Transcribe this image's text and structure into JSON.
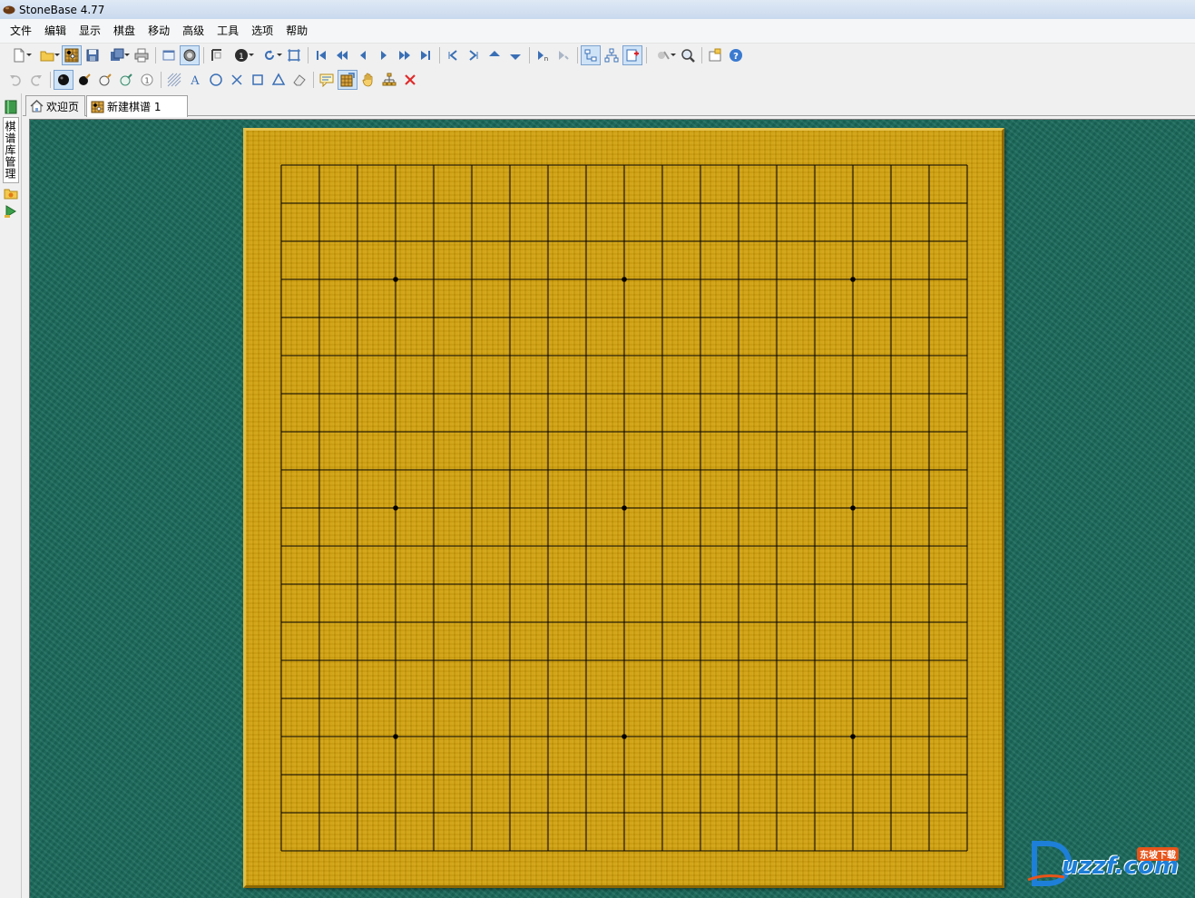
{
  "window": {
    "title": "StoneBase 4.77"
  },
  "menu": {
    "items": [
      "文件",
      "编辑",
      "显示",
      "棋盘",
      "移动",
      "高级",
      "工具",
      "选项",
      "帮助"
    ]
  },
  "toolbar1": {
    "icons": [
      "new-file-icon",
      "open-folder-icon",
      "board-view-icon",
      "save-icon",
      "save-as-icon",
      "print-icon",
      "window-icon",
      "stone-view-icon",
      "coordinates-icon",
      "move-number-icon",
      "rotate-icon",
      "frame-icon",
      "first-move-icon",
      "back-fast-icon",
      "back-icon",
      "forward-icon",
      "forward-fast-icon",
      "last-move-icon",
      "prev-variation-icon",
      "next-variation-icon",
      "up-icon",
      "down-icon",
      "goto-move-icon",
      "goto-end-icon",
      "tree-view-icon",
      "tree-branch-icon",
      "tree-add-icon",
      "analysis-icon",
      "search-icon",
      "properties-icon",
      "help-icon"
    ]
  },
  "toolbar2": {
    "icons": [
      "undo-icon",
      "redo-icon",
      "black-stone-icon",
      "black-move-icon",
      "white-stone-icon",
      "white-move-icon",
      "number-icon",
      "hatch-icon",
      "label-a-icon",
      "circle-icon",
      "cross-icon",
      "square-icon",
      "triangle-icon",
      "eraser-icon",
      "comment-icon",
      "board-edit-icon",
      "hand-icon",
      "tree-icon",
      "delete-icon"
    ],
    "number_label": "1",
    "label_a": "A"
  },
  "sidebar": {
    "panel_label": "棋谱库管理"
  },
  "tabs": [
    {
      "label": "欢迎页",
      "active": false
    },
    {
      "label": "新建棋谱 1",
      "active": true
    }
  ],
  "board": {
    "size": 19,
    "star_points": [
      [
        3,
        3
      ],
      [
        9,
        3
      ],
      [
        15,
        3
      ],
      [
        3,
        9
      ],
      [
        9,
        9
      ],
      [
        15,
        9
      ],
      [
        3,
        15
      ],
      [
        9,
        15
      ],
      [
        15,
        15
      ]
    ],
    "stones": []
  },
  "watermark": {
    "text": "uzzf.com",
    "badge": "东坡下载"
  },
  "colors": {
    "board_wood": "#d09f0a",
    "table_green": "#1a6a5b",
    "grid_line": "#000000"
  }
}
